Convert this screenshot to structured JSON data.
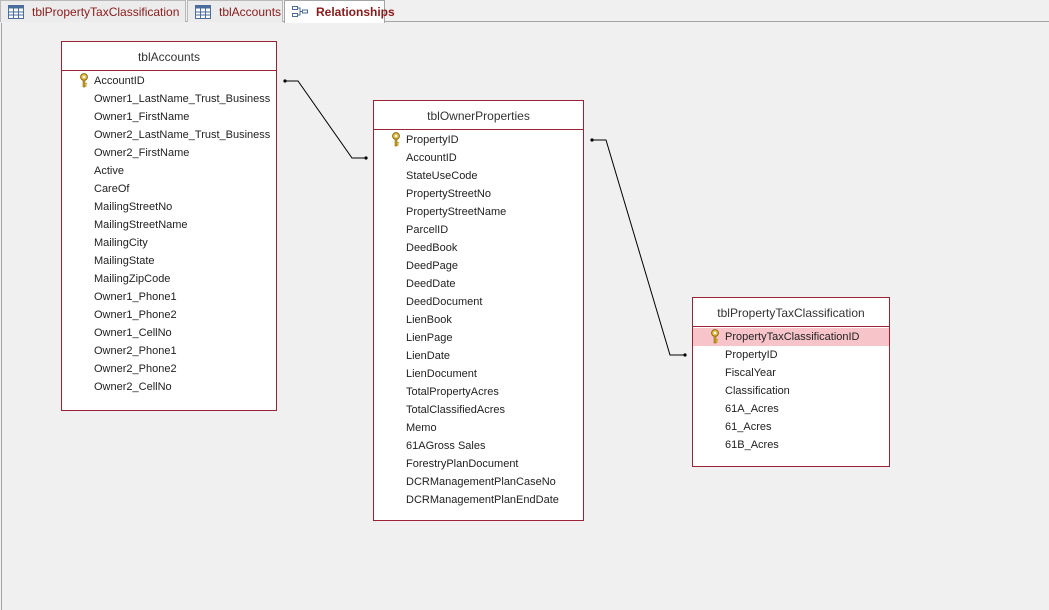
{
  "tabs": [
    {
      "label": "tblPropertyTaxClassification",
      "icon": "table-icon",
      "active": false
    },
    {
      "label": "tblAccounts",
      "icon": "table-icon",
      "active": false
    },
    {
      "label": "Relationships",
      "icon": "relationships-icon",
      "active": true
    }
  ],
  "tables": {
    "accounts": {
      "title": "tblAccounts",
      "fields": [
        "AccountID",
        "Owner1_LastName_Trust_Business",
        "Owner1_FirstName",
        "Owner2_LastName_Trust_Business",
        "Owner2_FirstName",
        "Active",
        "CareOf",
        "MailingStreetNo",
        "MailingStreetName",
        "MailingCity",
        "MailingState",
        "MailingZipCode",
        "Owner1_Phone1",
        "Owner1_Phone2",
        "Owner1_CellNo",
        "Owner2_Phone1",
        "Owner2_Phone2",
        "Owner2_CellNo"
      ],
      "primary_key": "AccountID"
    },
    "owner_properties": {
      "title": "tblOwnerProperties",
      "fields": [
        "PropertyID",
        "AccountID",
        "StateUseCode",
        "PropertyStreetNo",
        "PropertyStreetName",
        "ParcelID",
        "DeedBook",
        "DeedPage",
        "DeedDate",
        "DeedDocument",
        "LienBook",
        "LienPage",
        "LienDate",
        "LienDocument",
        "TotalPropertyAcres",
        "TotalClassifiedAcres",
        "Memo",
        "61AGross Sales",
        "ForestryPlanDocument",
        "DCRManagementPlanCaseNo",
        "DCRManagementPlanEndDate"
      ],
      "primary_key": "PropertyID"
    },
    "property_tax_classification": {
      "title": "tblPropertyTaxClassification",
      "fields": [
        "PropertyTaxClassificationID",
        "PropertyID",
        "FiscalYear",
        "Classification",
        "61A_Acres",
        "61_Acres",
        "61B_Acres"
      ],
      "primary_key": "PropertyTaxClassificationID",
      "selected_field": "PropertyTaxClassificationID"
    }
  },
  "relationships": [
    {
      "from": "tblAccounts.AccountID",
      "to": "tblOwnerProperties.AccountID"
    },
    {
      "from": "tblOwnerProperties.PropertyID",
      "to": "tblPropertyTaxClassification.PropertyID"
    }
  ],
  "colors": {
    "table_border": "#9b2335",
    "selected_row": "#f7c4c9",
    "tab_text": "#8b1a1a",
    "key_icon": "#c8a020"
  }
}
